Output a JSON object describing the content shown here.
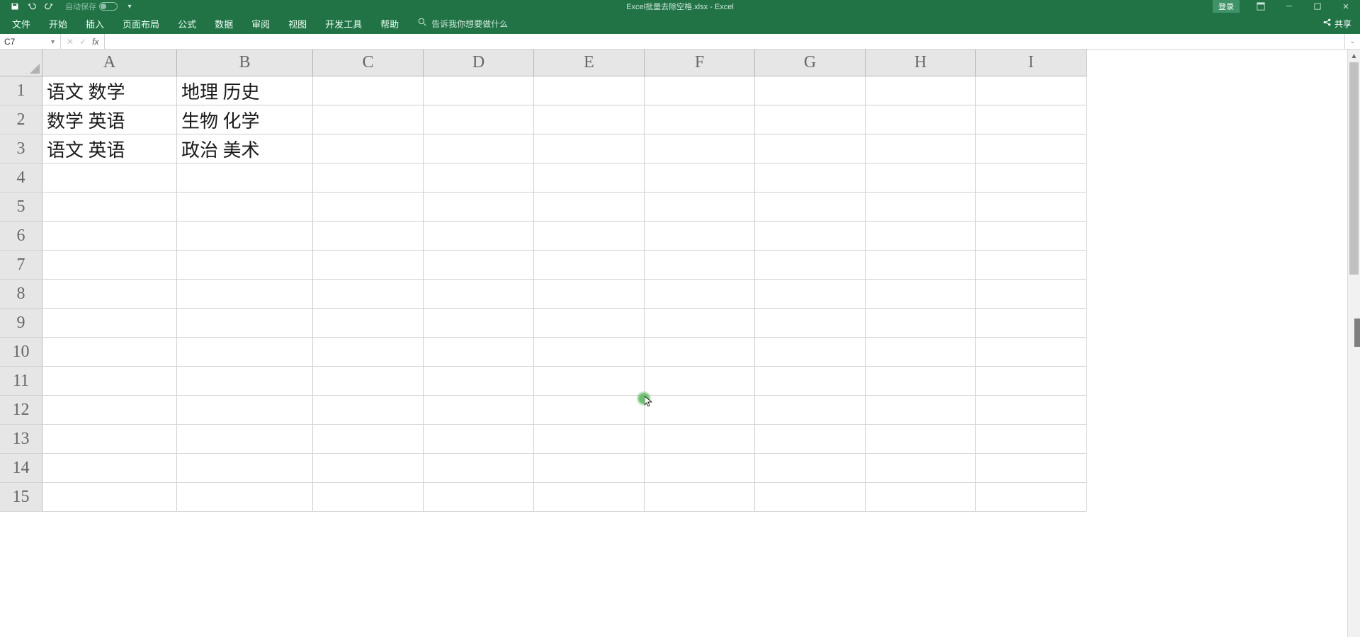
{
  "title": "Excel批量去除空格.xlsx - Excel",
  "qat": {
    "autosave_label": "自动保存"
  },
  "login_label": "登录",
  "ribbon_tabs": [
    "文件",
    "开始",
    "插入",
    "页面布局",
    "公式",
    "数据",
    "审阅",
    "视图",
    "开发工具",
    "帮助"
  ],
  "tellme_placeholder": "告诉我你想要做什么",
  "share_label": "共享",
  "namebox_value": "C7",
  "formula_value": "",
  "columns": [
    "A",
    "B",
    "C",
    "D",
    "E",
    "F",
    "G",
    "H",
    "I"
  ],
  "rows_count": 15,
  "cells": {
    "A1": "语文   数学",
    "B1": "地理     历史",
    "A2": "数学 英语",
    "B2": "生物 化学",
    "A3": "语文  英语",
    "B3": "政治 美术"
  }
}
